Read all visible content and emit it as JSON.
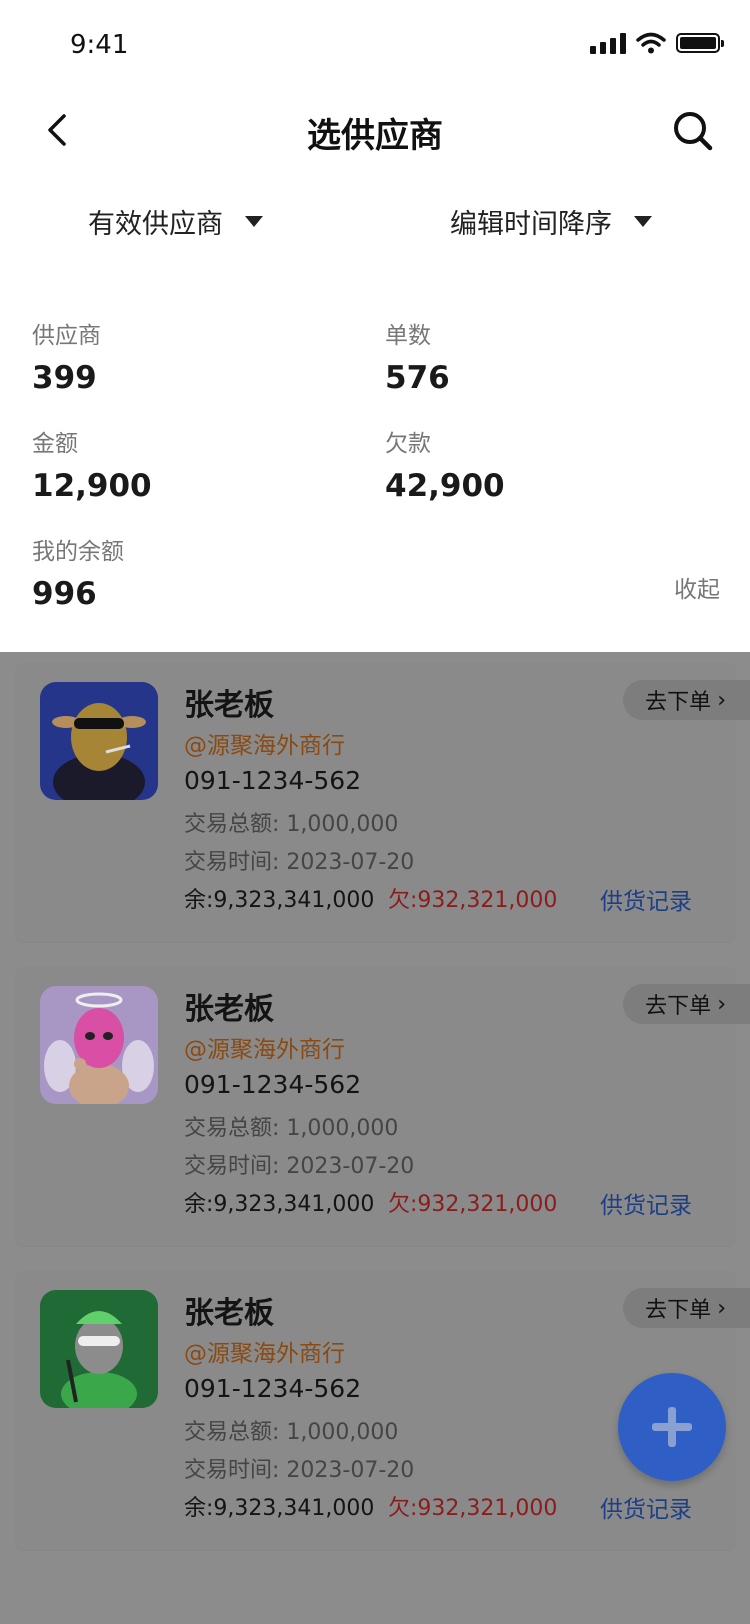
{
  "status_bar": {
    "time": "9:41"
  },
  "nav": {
    "title": "选供应商"
  },
  "filters": [
    {
      "label": "有效供应商"
    },
    {
      "label": "编辑时间降序"
    }
  ],
  "stats": {
    "suppliers": {
      "label": "供应商",
      "value": "399"
    },
    "orders": {
      "label": "单数",
      "value": "576"
    },
    "amount": {
      "label": "金额",
      "value": "12,900"
    },
    "debt": {
      "label": "欠款",
      "value": "42,900"
    },
    "balance": {
      "label": "我的余额",
      "value": "996"
    },
    "collapse_label": "收起"
  },
  "suppliers": [
    {
      "name": "张老板",
      "company": "@源聚海外商行",
      "phone": "091-1234-562",
      "total": "交易总额: 1,000,000",
      "time": "交易时间: 2023-07-20",
      "balance": "余:9,323,341,000",
      "debt": "欠:932,321,000",
      "record_label": "供货记录",
      "order_label": "去下单",
      "avatar_colors": {
        "bg": "#1e3a8a",
        "accent": "#c7a24a"
      }
    },
    {
      "name": "张老板",
      "company": "@源聚海外商行",
      "phone": "091-1234-562",
      "total": "交易总额: 1,000,000",
      "time": "交易时间: 2023-07-20",
      "balance": "余:9,323,341,000",
      "debt": "欠:932,321,000",
      "record_label": "供货记录",
      "order_label": "去下单",
      "avatar_colors": {
        "bg": "#b9a6d8",
        "accent": "#e15ab3"
      }
    },
    {
      "name": "张老板",
      "company": "@源聚海外商行",
      "phone": "091-1234-562",
      "total": "交易总额: 1,000,000",
      "time": "交易时间: 2023-07-20",
      "balance": "余:9,323,341,000",
      "debt": "欠:932,321,000",
      "record_label": "供货记录",
      "order_label": "去下单",
      "avatar_colors": {
        "bg": "#1f7a3a",
        "accent": "#9a9a9a"
      }
    }
  ],
  "icons": {
    "back": "chevron-left-icon",
    "search": "search-icon",
    "filter_caret": "caret-down-icon",
    "order_chevron": "chevron-right-icon",
    "fab": "plus-icon"
  },
  "colors": {
    "accent": "#2f5fc4",
    "debt_red": "#c0392b",
    "company_orange": "#c2691e",
    "record_blue": "#2f5fc4",
    "overlay": "#8c8c8c"
  }
}
